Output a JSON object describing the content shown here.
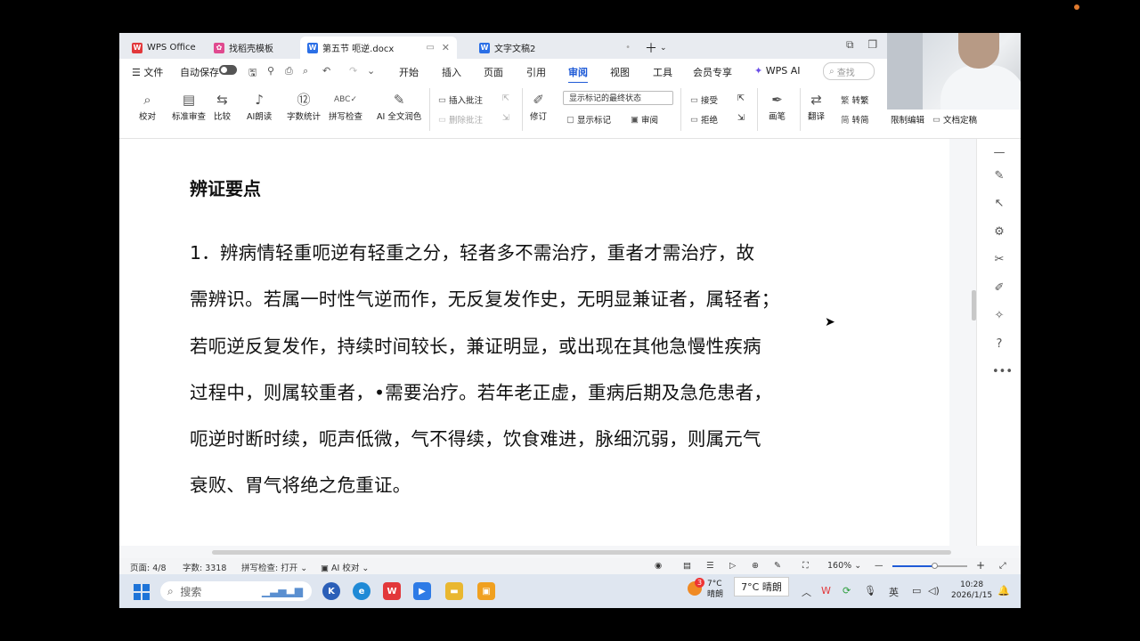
{
  "tabs": [
    {
      "label": "WPS Office",
      "color": "#e2383b"
    },
    {
      "label": "找稻壳模板",
      "color": "#e04a8f"
    },
    {
      "label": "第五节 呃逆.docx",
      "color": "#2b6fe6",
      "active": true
    },
    {
      "label": "文字文稿2",
      "color": "#2b6fe6"
    }
  ],
  "menu": {
    "file": "文件",
    "autosave": "自动保存",
    "items": [
      "开始",
      "插入",
      "页面",
      "引用",
      "审阅",
      "视图",
      "工具",
      "会员专享",
      "WPS AI"
    ],
    "active": "审阅",
    "search_placeholder": "查找"
  },
  "ribbon": {
    "proofread": "校对",
    "standard_review": "标准审查",
    "compare": "比较",
    "ai_read": "AI朗读",
    "word_count": "字数统计",
    "spell_check": "拼写检查",
    "ai_polish": "AI 全文润色",
    "insert_comment": "插入批注",
    "delete_comment": "删除批注",
    "revise": "修订",
    "show_final": "显示标记的最终状态",
    "show_markup": "显示标记",
    "review": "审阅",
    "accept": "接受",
    "reject": "拒绝",
    "pen": "画笔",
    "translate": "翻译",
    "to_traditional": "转繁",
    "to_simplified": "转简",
    "restrict_edit": "限制编辑",
    "finalize": "文档定稿"
  },
  "document": {
    "heading": "辨证要点",
    "lines": [
      "1．辨病情轻重呃逆有轻重之分，轻者多不需治疗，重者才需治疗，故",
      "需辨识。若属一时性气逆而作，无反复发作史，无明显兼证者，属轻者；",
      "若呃逆反复发作，持续时间较长，兼证明显，或出现在其他急慢性疾病",
      "过程中，则属较重者，•需要治疗。若年老正虚，重病后期及急危患者，",
      "呃逆时断时续，呃声低微，气不得续，饮食难进，脉细沉弱，则属元气",
      "衰败、胃气将绝之危重证。"
    ]
  },
  "status": {
    "page": "页面: 4/8",
    "word_count": "字数: 3318",
    "spell": "拼写检查: 打开",
    "ai_check": "AI 校对",
    "zoom": "160%"
  },
  "taskbar": {
    "search": "搜索",
    "weather_temp": "7°C",
    "weather_desc": "晴朗",
    "weather_popup": "7°C 晴朗",
    "badge": "3",
    "ime": "英",
    "time": "10:28",
    "date": "2026/1/15"
  },
  "colors": {
    "accent": "#1f5bd7",
    "wps_red": "#e2383b"
  }
}
